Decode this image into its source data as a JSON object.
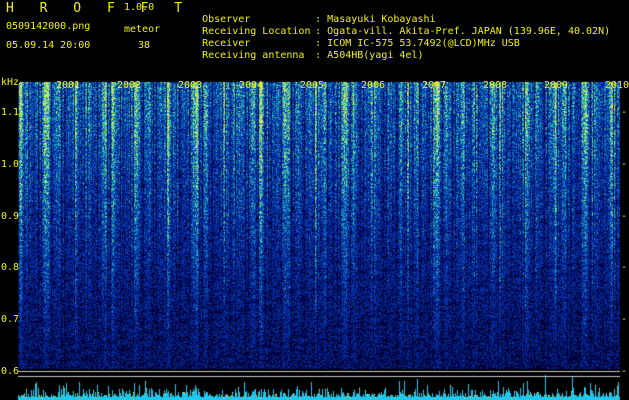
{
  "header": {
    "app_name": "H R O F F T",
    "version": "1.0.0",
    "filename": "0509142000.png",
    "timestamp": "05.09.14 20:00",
    "meteor_label": "meteor",
    "meteor_count": "38"
  },
  "station_info": [
    {
      "label": "Observer",
      "sep": ":",
      "value": "Masayuki Kobayashi"
    },
    {
      "label": "Receiving Location",
      "sep": ":",
      "value": "Ogata-vill. Akita-Pref. JAPAN (139.96E, 40.02N)"
    },
    {
      "label": "Receiver",
      "sep": ":",
      "value": "ICOM IC-575 53.7492(@LCD)MHz USB"
    },
    {
      "label": "Receiving antenna",
      "sep": ":",
      "value": "A504HB(yagi 4el)"
    }
  ],
  "chart_data": {
    "type": "heatmap",
    "ylabel": "kHz",
    "y_ticks": [
      "1.1",
      "1.0",
      "0.9",
      "0.8",
      "0.7",
      "0.6"
    ],
    "y_tick_values": [
      1.1,
      1.0,
      0.9,
      0.8,
      0.7,
      0.6
    ],
    "ylim": [
      0.6,
      1.16
    ],
    "x_labels": [
      "2001",
      "2002",
      "2003",
      "2004",
      "2005",
      "2006",
      "2007",
      "2008",
      "2009",
      "2010"
    ],
    "colors": {
      "low": "#000040",
      "mid": "#1030c0",
      "high": "#30e0a0",
      "peak": "#f0f040",
      "text": "#f2f20a",
      "baseline": "#20c0f0"
    }
  }
}
